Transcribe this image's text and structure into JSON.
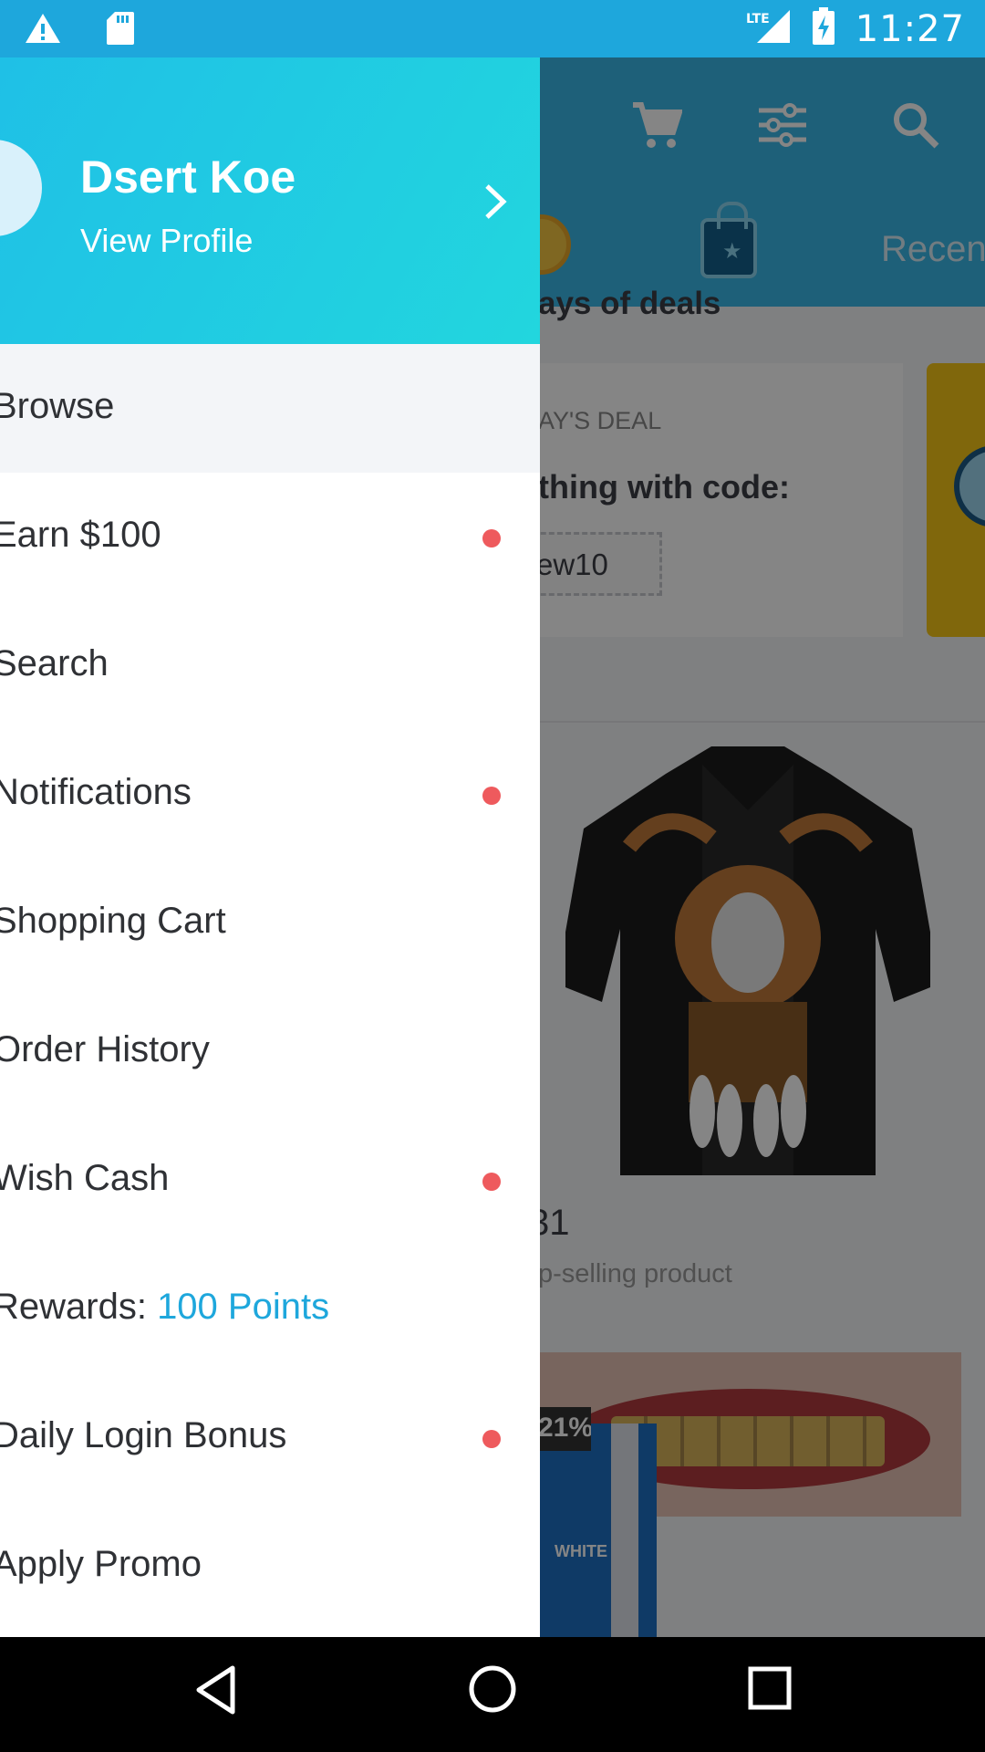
{
  "status_bar": {
    "time": "11:27",
    "network": "LTE",
    "icons": [
      "warning-icon",
      "sd-card-icon",
      "signal-icon",
      "battery-charging-icon"
    ]
  },
  "background_app": {
    "header_icons": [
      "cart-icon",
      "filter-icon",
      "search-icon"
    ],
    "tab_label": "Recen",
    "deals_title": "ays of deals",
    "deal_label": "AY'S DEAL",
    "deal_text": "thing with code:",
    "deal_code": "ew10",
    "price": "31",
    "product_subtitle": "p-selling product",
    "discount_badge": "21%",
    "toothpaste_brand": "WHITE"
  },
  "drawer": {
    "user_name": "Dsert Koe",
    "view_profile": "View Profile",
    "items": [
      {
        "label": "Browse",
        "dot": false,
        "active": true
      },
      {
        "label": "Earn $100",
        "dot": true
      },
      {
        "label": "Search",
        "dot": false
      },
      {
        "label": "Notifications",
        "dot": true
      },
      {
        "label": "Shopping Cart",
        "dot": false
      },
      {
        "label": "Order History",
        "dot": false
      },
      {
        "label": "Wish Cash",
        "dot": true
      },
      {
        "label": "Rewards: ",
        "accent": "100 Points",
        "dot": false
      },
      {
        "label": "Daily Login Bonus",
        "dot": true
      },
      {
        "label": "Apply Promo",
        "dot": false
      }
    ]
  },
  "nav_bar": {
    "buttons": [
      "back-icon",
      "home-icon",
      "recents-icon"
    ]
  },
  "colors": {
    "status_bar": "#1ea7dc",
    "accent": "#1ea7dc",
    "notification_dot": "#ee5a5d"
  }
}
